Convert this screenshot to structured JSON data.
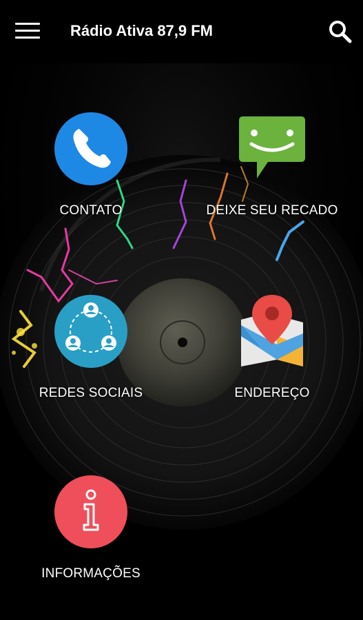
{
  "app_bar": {
    "title": "Rádio Ativa 87,9 FM",
    "menu_icon": "hamburger-menu-icon",
    "search_icon": "search-icon"
  },
  "menu": [
    {
      "id": "contato",
      "label": "CONTATO",
      "icon": "phone-icon",
      "color": "#1e88e5"
    },
    {
      "id": "recado",
      "label": "DEIXE SEU RECADO",
      "icon": "chat-smile-icon",
      "color": "#6bb33c"
    },
    {
      "id": "redes",
      "label": "REDES SOCIAIS",
      "icon": "social-network-icon",
      "color": "#2a9fc6"
    },
    {
      "id": "endereco",
      "label": "ENDEREÇO",
      "icon": "map-pin-icon",
      "color": "#e94b47"
    },
    {
      "id": "info",
      "label": "INFORMAÇÕES",
      "icon": "info-icon",
      "color": "#ef4f5a"
    }
  ],
  "colors": {
    "background": "#000000",
    "text": "#ffffff"
  }
}
